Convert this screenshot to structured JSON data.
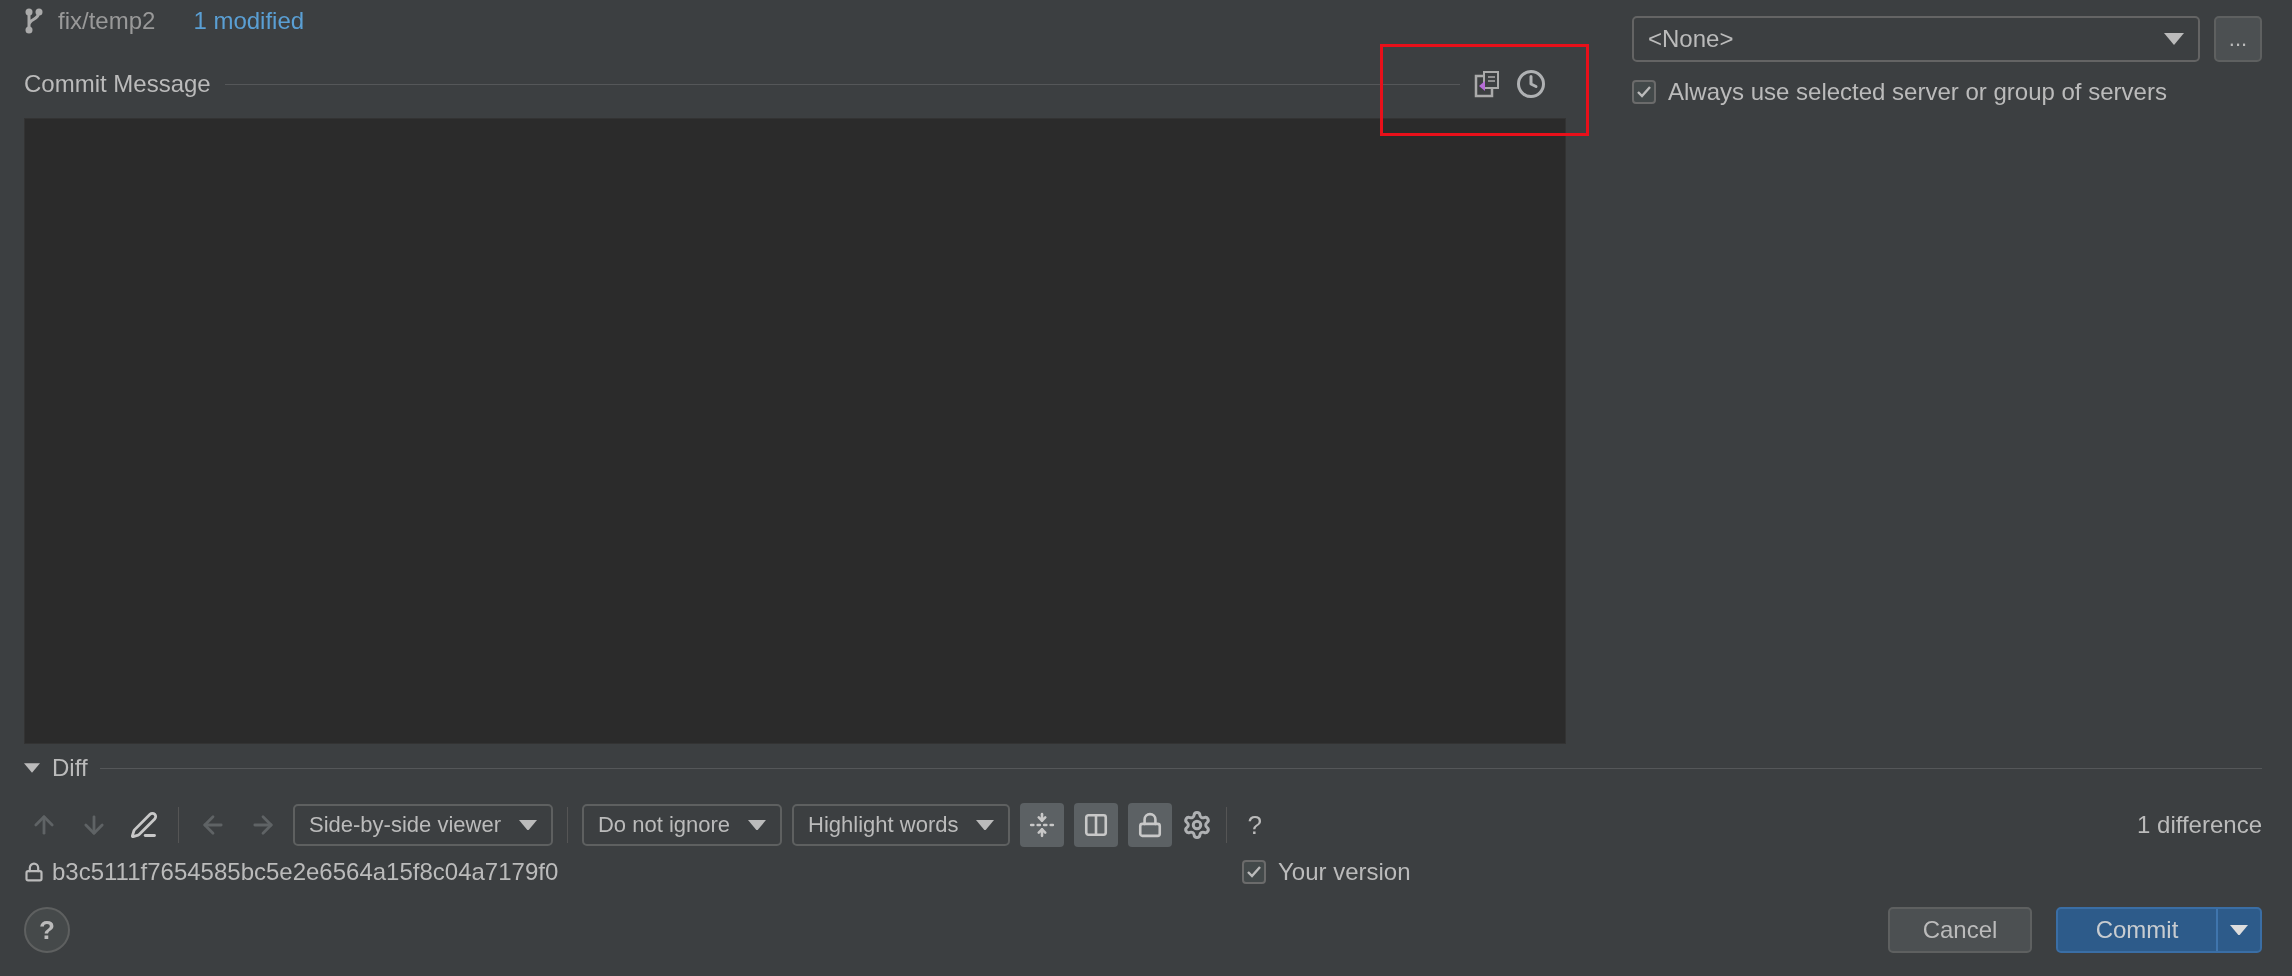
{
  "branch": {
    "name": "fix/temp2",
    "changes": "1 modified"
  },
  "commit_message": {
    "label": "Commit Message"
  },
  "server": {
    "selection": "<None>",
    "browse": "...",
    "always_use": {
      "label": "Always use selected server or group of servers",
      "checked": true
    }
  },
  "diff": {
    "title": "Diff",
    "expanded": true,
    "nav": [
      {
        "kind": "up",
        "disabled": true
      },
      {
        "kind": "down",
        "disabled": true
      },
      {
        "kind": "edit",
        "disabled": false
      },
      {
        "kind": "left",
        "disabled": true
      },
      {
        "kind": "right",
        "disabled": true
      }
    ],
    "dropdowns": [
      "Side-by-side viewer",
      "Do not ignore",
      "Highlight words"
    ],
    "toggles": [
      {
        "kind": "collapse",
        "selected": true
      },
      {
        "kind": "sync",
        "selected": true
      },
      {
        "kind": "lock",
        "selected": true
      }
    ],
    "help": "?",
    "summary": "1 difference",
    "revision": "b3c5111f7654585bc5e2e6564a15f8c04a7179f0",
    "your_version": {
      "label": "Your version",
      "checked": true
    }
  },
  "footer": {
    "help": "?",
    "cancel": "Cancel",
    "commit": "Commit"
  }
}
